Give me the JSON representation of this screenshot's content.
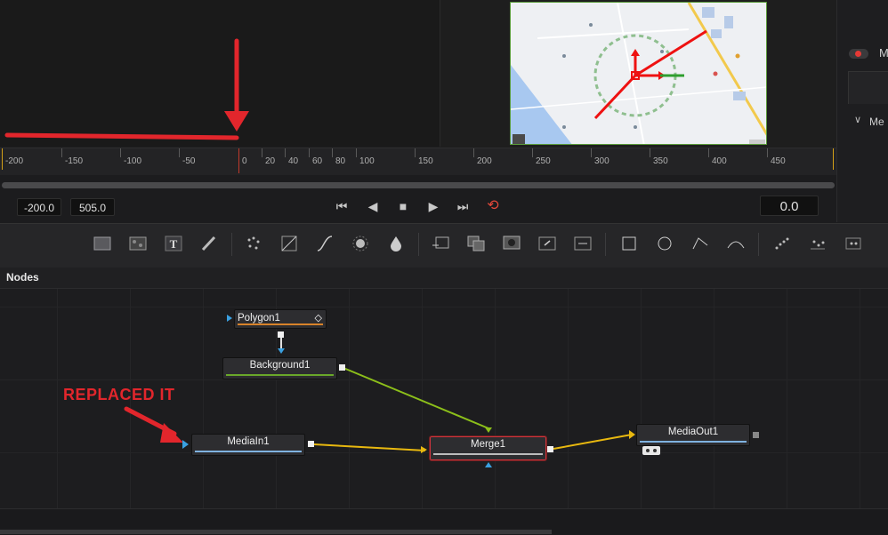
{
  "ruler": {
    "labels": [
      "-200",
      "-150",
      "-100",
      "-50",
      "0",
      "20",
      "40",
      "60",
      "80",
      "100",
      "150",
      "200",
      "250",
      "300",
      "350",
      "400",
      "450"
    ]
  },
  "transport": {
    "range_start": "-200.0",
    "range_end": "505.0",
    "current_time": "0.0"
  },
  "inspector": {
    "toggle_label": "Me",
    "section_label": "Me"
  },
  "nodes_panel": {
    "title": "Nodes"
  },
  "nodes": {
    "polygon": "Polygon1",
    "background": "Background1",
    "mediain": "MediaIn1",
    "merge": "Merge1",
    "mediaout": "MediaOut1"
  },
  "annotation": {
    "text": "REPLACED IT",
    "color": "#e2262c"
  },
  "colors": {
    "mask_link": "#3aa0e0",
    "background_link": "#8cbf1a",
    "main_link": "#e8b80f",
    "selection": "#d0343c"
  },
  "toolbar_icons": [
    "background-icon",
    "fast-noise-icon",
    "text-icon",
    "paint-icon",
    "particles-icon",
    "grid-warp-icon",
    "curves-icon",
    "brightness-contrast-icon",
    "blur-icon",
    "merge-icon",
    "channel-booleans-icon",
    "matte-control-icon",
    "transform-icon",
    "resize-icon",
    "rectangle-mask-icon",
    "ellipse-mask-icon",
    "polygon-mask-icon",
    "bspline-mask-icon",
    "particle-emitter-icon",
    "particle-render-icon",
    "point-tracker-icon"
  ]
}
